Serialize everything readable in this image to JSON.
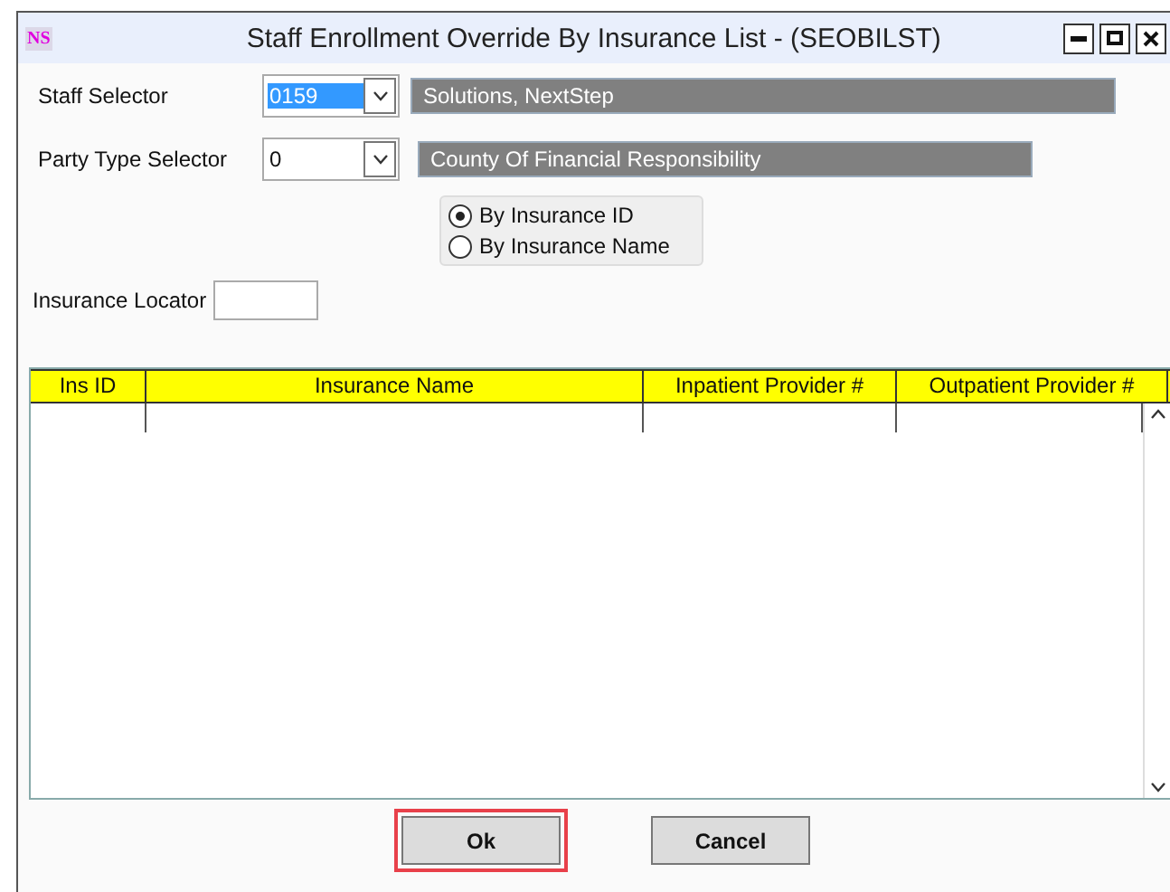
{
  "window": {
    "title": "Staff Enrollment Override By Insurance List - (SEOBILST)",
    "logo": "NS"
  },
  "staff_selector": {
    "label": "Staff Selector",
    "value": "0159",
    "value_selected": true,
    "description": "Solutions, NextStep"
  },
  "party_type_selector": {
    "label": "Party Type Selector",
    "value": "0",
    "value_selected": false,
    "description": "County Of Financial Responsibility"
  },
  "search_mode": [
    {
      "label": "By Insurance ID",
      "selected": true
    },
    {
      "label": "By Insurance Name",
      "selected": false
    }
  ],
  "insurance_locator": {
    "label": "Insurance Locator"
  },
  "table": {
    "columns": [
      "Ins ID",
      "Insurance Name",
      "Inpatient Provider #",
      "Outpatient Provider #"
    ]
  },
  "buttons": [
    {
      "label": "Ok",
      "highlighted": true
    },
    {
      "label": "Cancel",
      "highlighted": false
    }
  ]
}
